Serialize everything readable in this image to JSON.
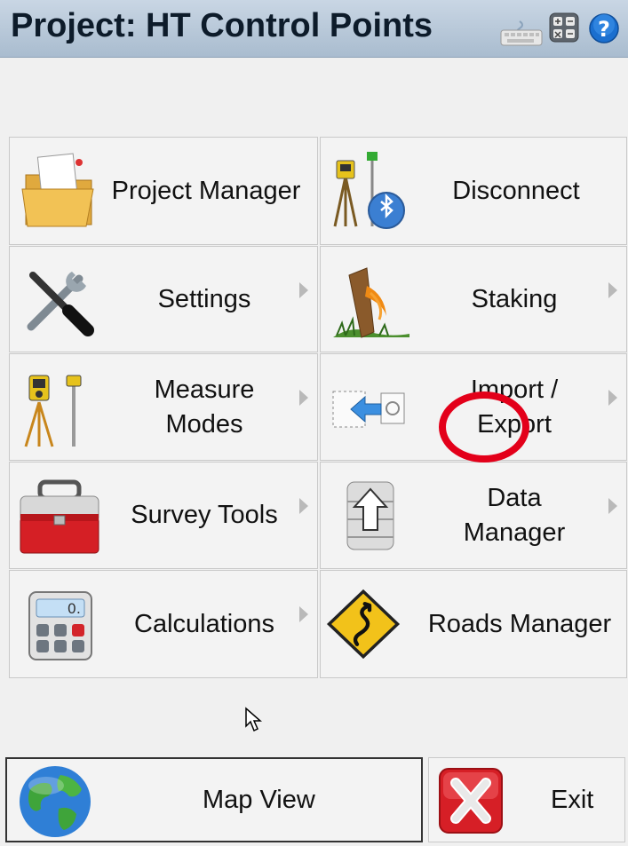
{
  "header": {
    "title": "Project: HT Control Points",
    "icons": [
      "keyboard-icon",
      "calculator-icon",
      "help-icon"
    ]
  },
  "menu": {
    "project_manager": "Project Manager",
    "disconnect": "Disconnect",
    "settings": "Settings",
    "staking": "Staking",
    "measure_modes": "Measure\nModes",
    "import_export": "Import /\nExport",
    "survey_tools": "Survey Tools",
    "data_manager": "Data\nManager",
    "calculations": "Calculations",
    "roads_manager": "Roads Manager"
  },
  "footer": {
    "map_view": "Map View",
    "exit": "Exit"
  },
  "colors": {
    "titlebar": "#b7c7d8",
    "highlight_ring": "#e3001a",
    "tile_bg": "#f3f3f3"
  }
}
